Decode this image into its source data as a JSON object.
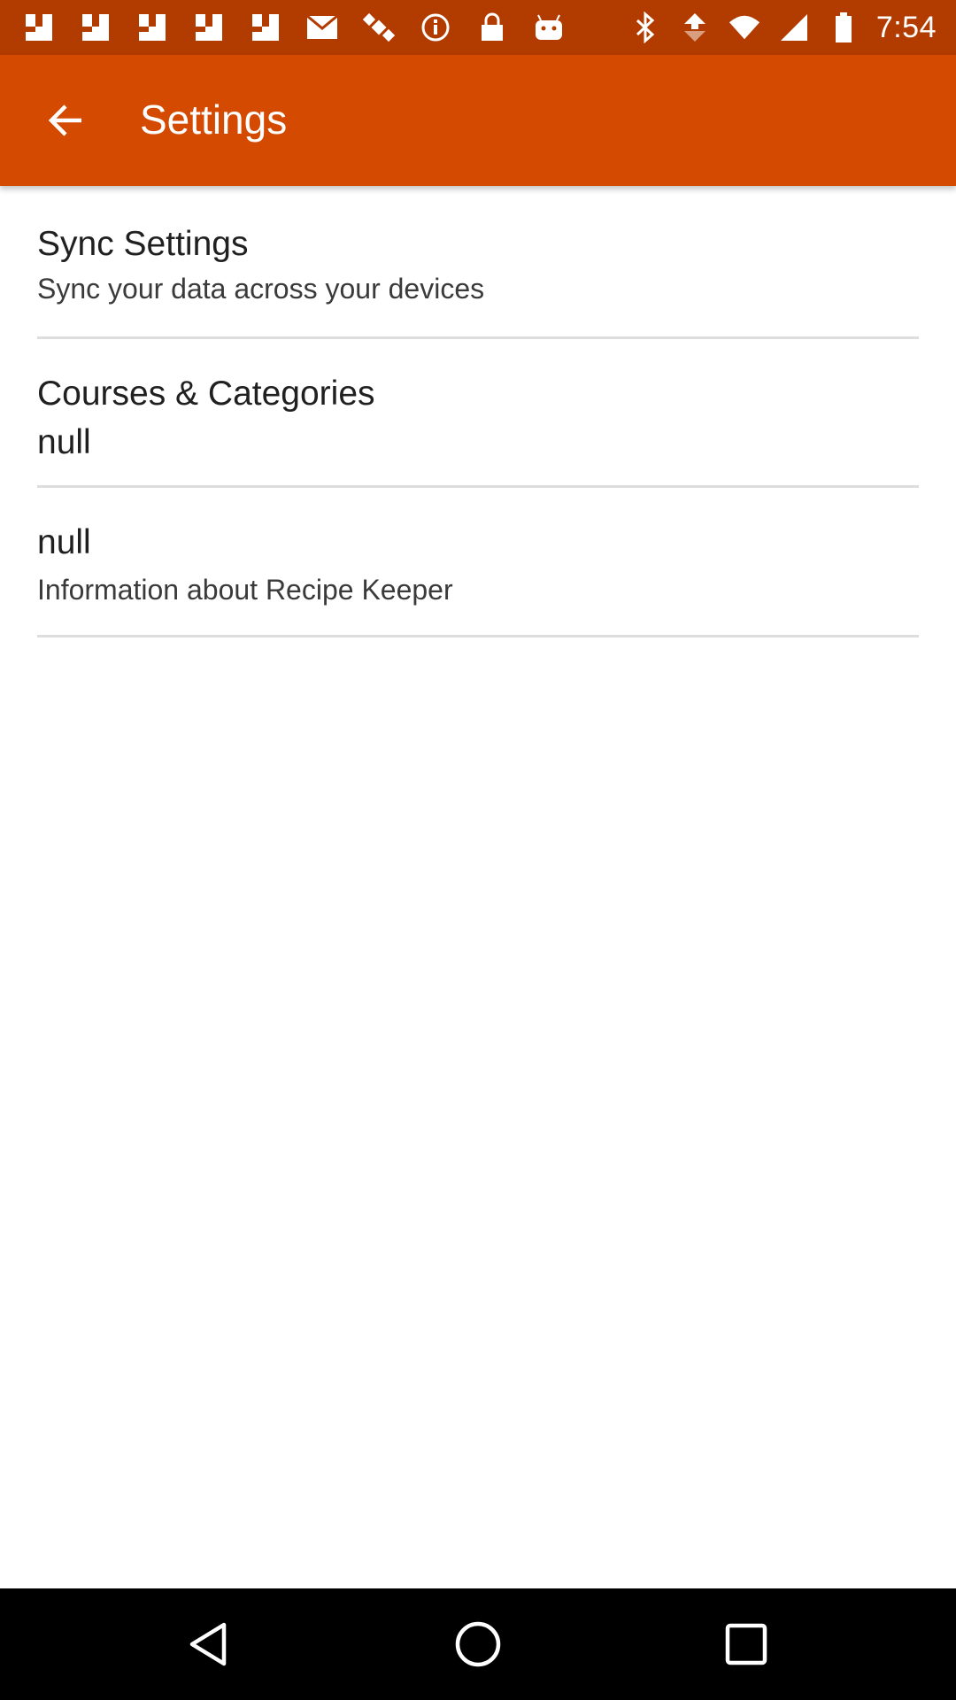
{
  "status_bar": {
    "time": "7:54",
    "left_icons": [
      "notification-square-icon",
      "notification-square-icon",
      "notification-square-icon",
      "notification-square-icon",
      "notification-square-icon",
      "mail-icon",
      "satellite-icon",
      "info-icon",
      "lock-icon",
      "android-icon"
    ],
    "right_icons": [
      "bluetooth-icon",
      "data-sync-icon",
      "wifi-icon",
      "signal-icon",
      "battery-icon"
    ]
  },
  "app_bar": {
    "title": "Settings",
    "color": "#d34a00"
  },
  "settings": [
    {
      "title": "Sync Settings",
      "subtitle": "Sync your data across your devices"
    },
    {
      "title": "Courses & Categories",
      "subtitle": "null"
    },
    {
      "title": "null",
      "subtitle": "Information about Recipe Keeper"
    }
  ],
  "nav_bar": {
    "buttons": [
      "back-triangle-icon",
      "home-circle-icon",
      "recents-square-icon"
    ]
  }
}
